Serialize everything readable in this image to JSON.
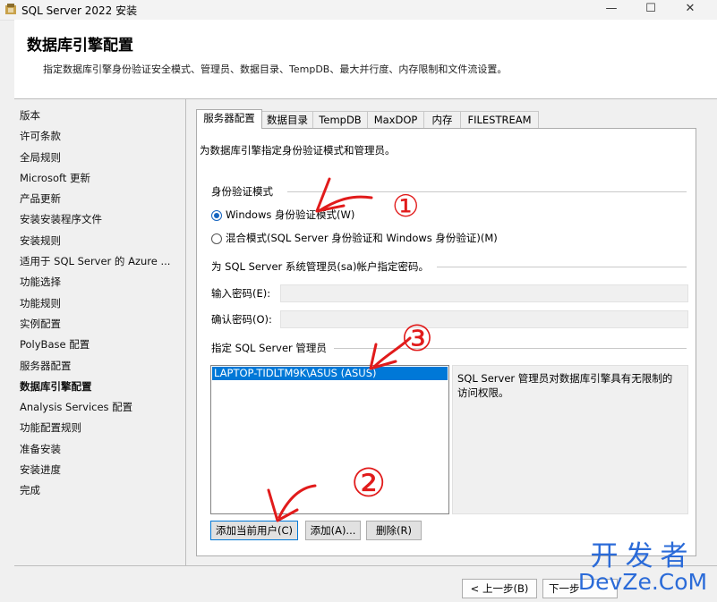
{
  "window": {
    "title": "SQL Server 2022 安装",
    "min": "—",
    "max": "☐",
    "close": "✕"
  },
  "header": {
    "title": "数据库引擎配置",
    "subtitle": "指定数据库引擎身份验证安全模式、管理员、数据目录、TempDB、最大并行度、内存限制和文件流设置。"
  },
  "nav": {
    "items": [
      "版本",
      "许可条款",
      "全局规则",
      "Microsoft 更新",
      "产品更新",
      "安装安装程序文件",
      "安装规则",
      "适用于 SQL Server 的 Azure ...",
      "功能选择",
      "功能规则",
      "实例配置",
      "PolyBase 配置",
      "服务器配置",
      "数据库引擎配置",
      "Analysis Services 配置",
      "功能配置规则",
      "准备安装",
      "安装进度",
      "完成"
    ],
    "active_index": 13
  },
  "tabs": [
    "服务器配置",
    "数据目录",
    "TempDB",
    "MaxDOP",
    "内存",
    "FILESTREAM"
  ],
  "panel": {
    "intro": "为数据库引擎指定身份验证模式和管理员。",
    "auth_group": "身份验证模式",
    "radio_windows": "Windows 身份验证模式(W)",
    "radio_mixed": "混合模式(SQL Server 身份验证和 Windows 身份验证)(M)",
    "sa_group": "为 SQL Server 系统管理员(sa)帐户指定密码。",
    "enter_pwd": "输入密码(E):",
    "confirm_pwd": "确认密码(O):",
    "admin_group": "指定 SQL Server 管理员",
    "admins": [
      "LAPTOP-TIDLTM9K\\ASUS (ASUS)"
    ],
    "admin_desc": "SQL Server 管理员对数据库引擎具有无限制的访问权限。",
    "btn_add_current": "添加当前用户(C)",
    "btn_add": "添加(A)...",
    "btn_remove": "删除(R)"
  },
  "footer": {
    "back": "< 上一步(B)",
    "next": "下一步"
  },
  "watermark": {
    "line1": "开发者",
    "line2": "DevZe.CoM"
  },
  "annotations": {
    "n1": "①",
    "n2": "②",
    "n3": "③"
  },
  "colors": {
    "accent": "#0078d7",
    "annotation": "#e11b1b",
    "watermark": "#2b6bd8"
  }
}
